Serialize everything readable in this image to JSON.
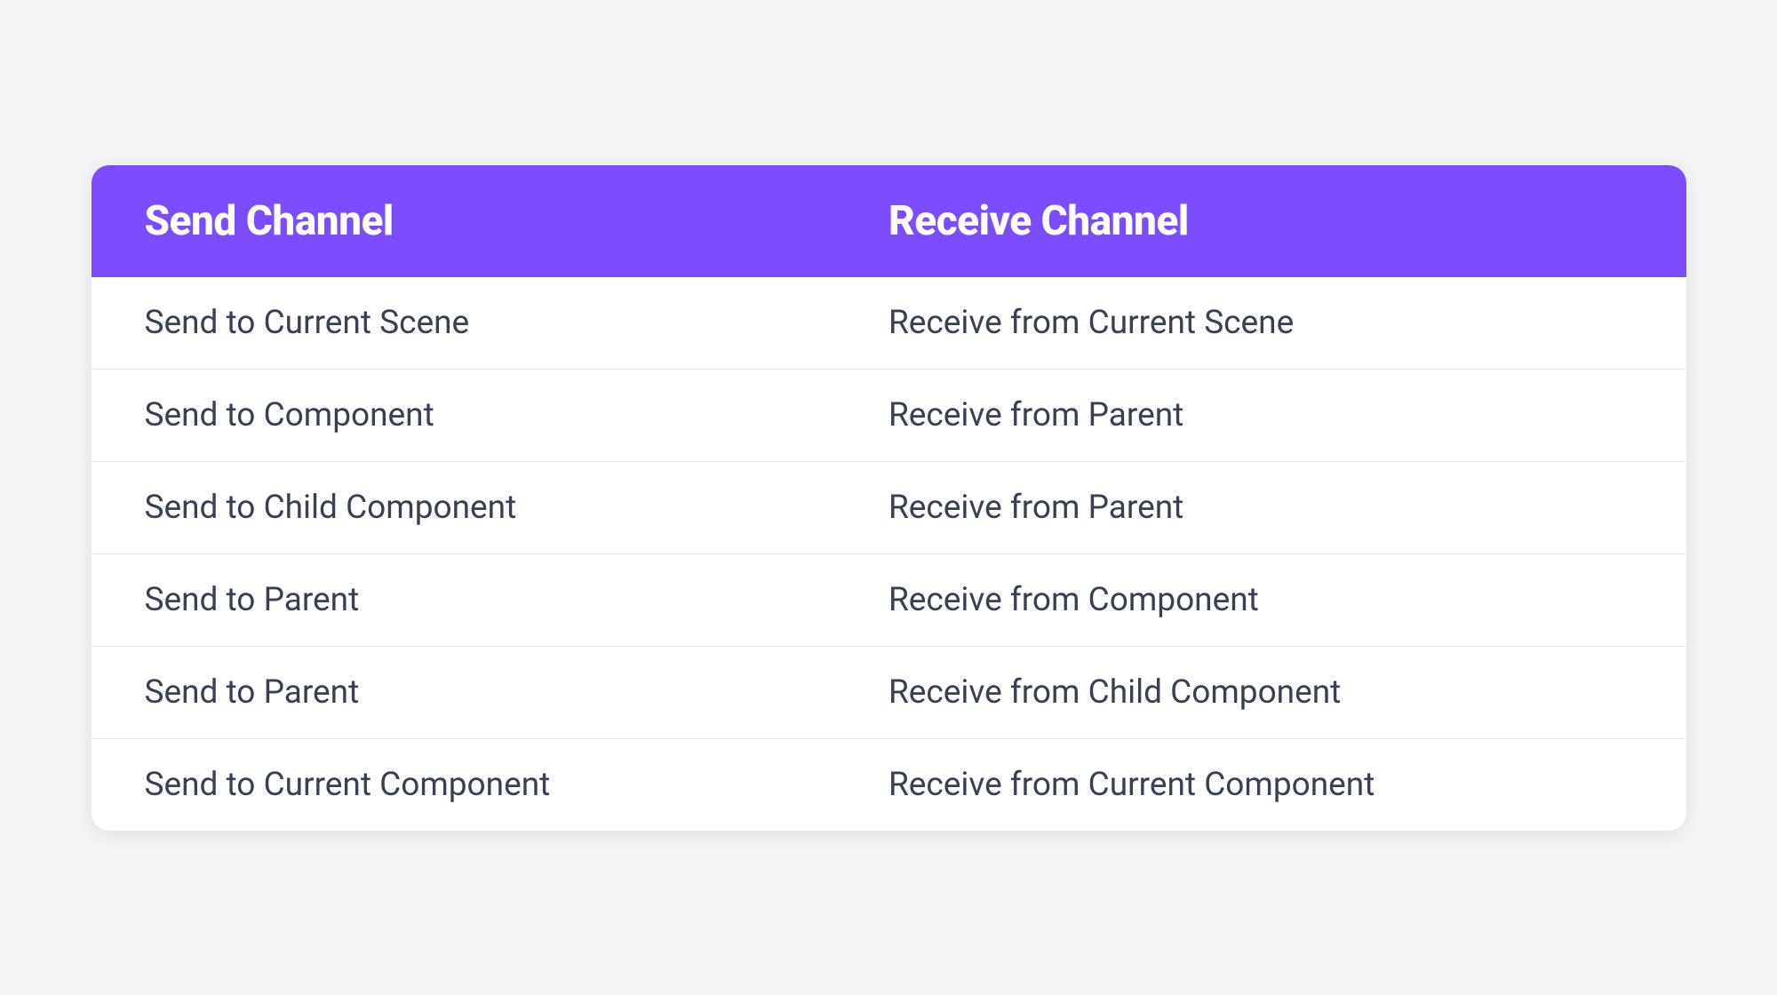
{
  "table": {
    "headers": {
      "send": "Send Channel",
      "receive": "Receive Channel"
    },
    "rows": [
      {
        "send": "Send to Current Scene",
        "receive": "Receive from Current Scene"
      },
      {
        "send": "Send to Component",
        "receive": "Receive from Parent"
      },
      {
        "send": "Send to Child Component",
        "receive": "Receive from Parent"
      },
      {
        "send": "Send to Parent",
        "receive": "Receive from Component"
      },
      {
        "send": "Send to Parent",
        "receive": "Receive from Child Component"
      },
      {
        "send": "Send to Current Component",
        "receive": "Receive from Current Component"
      }
    ]
  }
}
